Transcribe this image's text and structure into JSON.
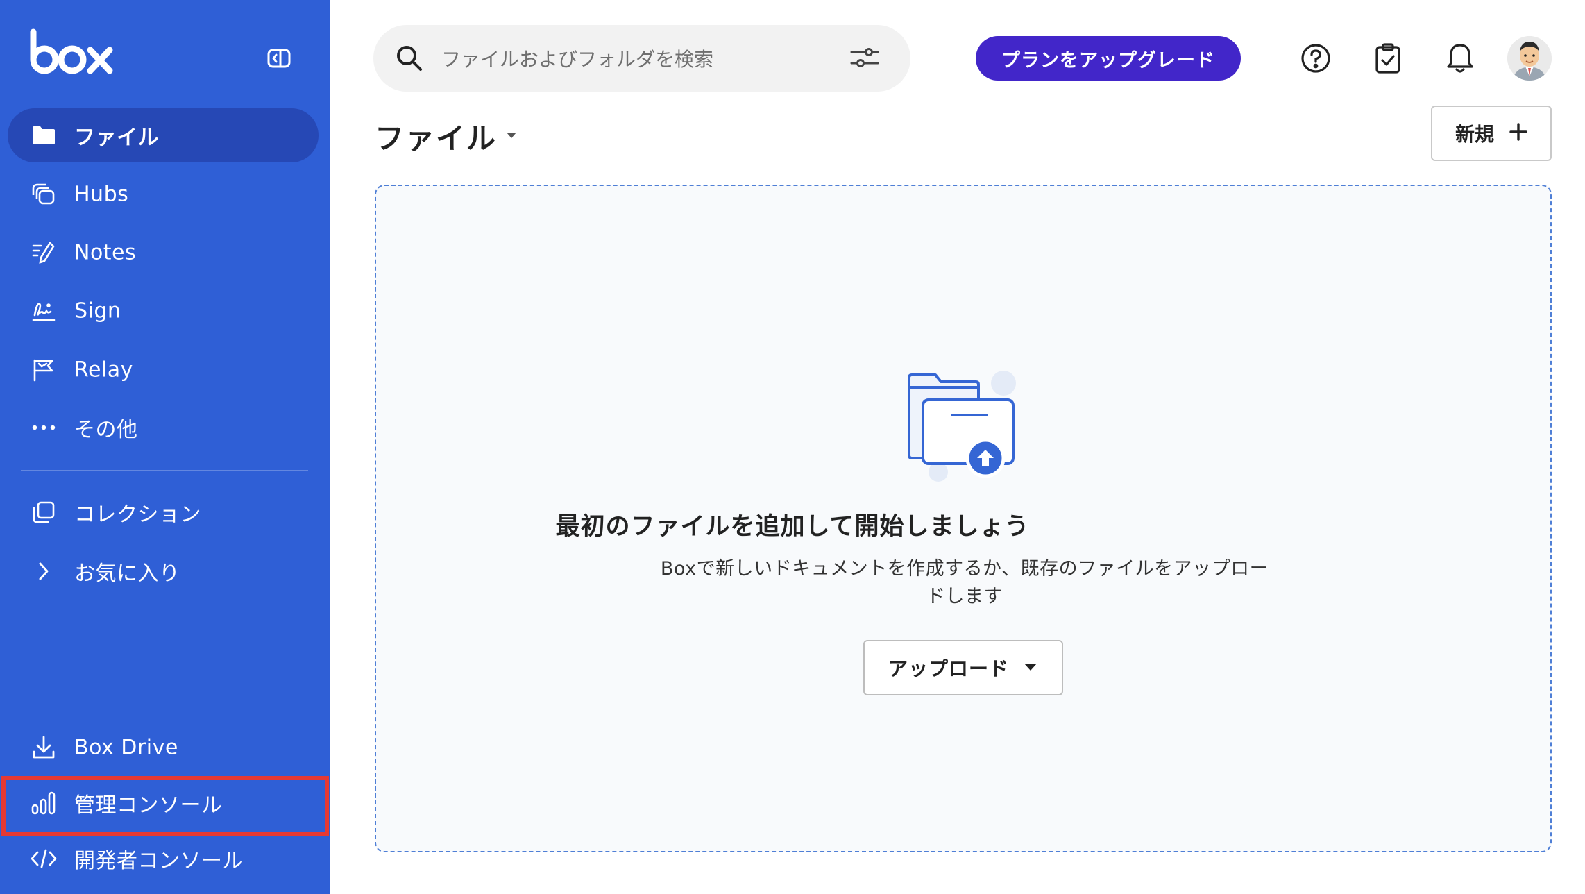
{
  "brand": {
    "logo_text": "box",
    "sidebar_color": "#2f5fd6",
    "active_color": "#2648b5"
  },
  "sidebar": {
    "items": [
      {
        "label": "ファイル",
        "icon": "folder-icon"
      },
      {
        "label": "Hubs",
        "icon": "hubs-icon"
      },
      {
        "label": "Notes",
        "icon": "notes-icon"
      },
      {
        "label": "Sign",
        "icon": "sign-icon"
      },
      {
        "label": "Relay",
        "icon": "relay-icon"
      },
      {
        "label": "その他",
        "icon": "more-icon"
      }
    ],
    "secondary": [
      {
        "label": "コレクション",
        "icon": "collection-icon"
      },
      {
        "label": "お気に入り",
        "icon": "chevron-right-icon"
      }
    ],
    "bottom": [
      {
        "label": "Box Drive",
        "icon": "download-icon"
      },
      {
        "label": "管理コンソール",
        "icon": "bar-chart-icon"
      },
      {
        "label": "開発者コンソール",
        "icon": "code-icon"
      }
    ]
  },
  "search": {
    "placeholder": "ファイルおよびフォルダを検索"
  },
  "header": {
    "upgrade_label": "プランをアップグレード",
    "upgrade_color": "#4226c9"
  },
  "page": {
    "title": "ファイル",
    "new_label": "新規"
  },
  "empty_state": {
    "title": "最初のファイルを追加して開始しましょう",
    "description": "Boxで新しいドキュメントを作成するか、既存のファイルをアップロードします",
    "upload_label": "アップロード"
  },
  "highlight_color": "#e53935"
}
